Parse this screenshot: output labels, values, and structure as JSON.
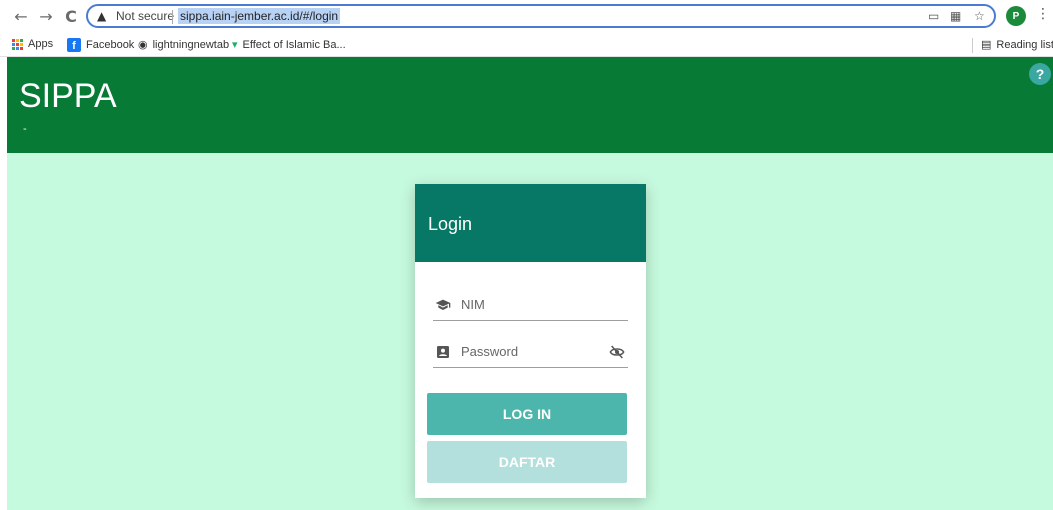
{
  "browser": {
    "nav": {
      "back": "←",
      "forward": "→",
      "reload": "C"
    },
    "security_label": "Not secure",
    "url": "sippa.iain-jember.ac.id/#/login",
    "profile_initial": "P",
    "bookmarks": [
      {
        "label": "Apps"
      },
      {
        "label": "Facebook"
      },
      {
        "label": "lightningnewtab"
      },
      {
        "label": "Effect of Islamic Ba..."
      }
    ],
    "reading_list": "Reading list"
  },
  "app": {
    "title": "SIPPA",
    "subtitle": "-",
    "help": "?"
  },
  "login": {
    "title": "Login",
    "nim_label": "NIM",
    "password_label": "Password",
    "login_button": "LOG IN",
    "register_button": "DAFTAR"
  },
  "colors": {
    "header": "#077a35",
    "card_header": "#077866",
    "page_bg": "#c6fade",
    "login_btn": "#4db6ac",
    "daftar_btn": "#b3dfdd"
  }
}
